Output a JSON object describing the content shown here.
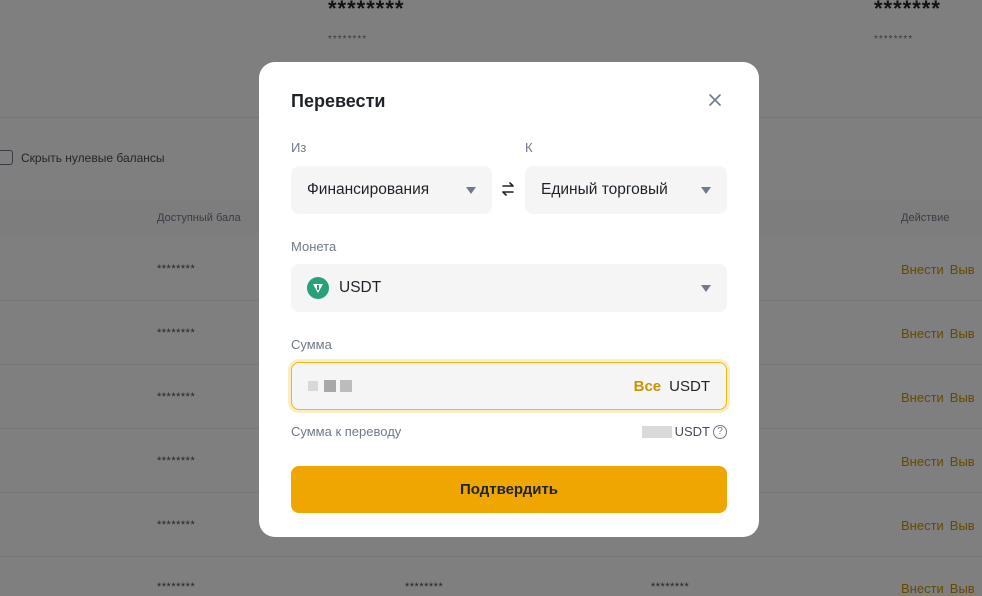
{
  "background": {
    "stats": [
      {
        "value": "********",
        "sub": "********"
      },
      {
        "value": "*******",
        "sub": "********"
      }
    ],
    "hide_zero_label": "Скрыть нулевые балансы",
    "table": {
      "headers": {
        "available": "Доступный бала",
        "action": "Действие"
      },
      "rows": [
        {
          "c1": "********",
          "deposit": "Внести",
          "withdraw": "Выв"
        },
        {
          "c1": "********",
          "deposit": "Внести",
          "withdraw": "Выв"
        },
        {
          "c1": "********",
          "deposit": "Внести",
          "withdraw": "Выв"
        },
        {
          "c1": "********",
          "deposit": "Внести",
          "withdraw": "Выв"
        },
        {
          "c1": "********",
          "deposit": "Внести",
          "withdraw": "Выв"
        },
        {
          "c1": "********",
          "c2": "********",
          "c3": "********",
          "deposit": "Внести",
          "withdraw": "Выв"
        }
      ]
    }
  },
  "modal": {
    "title": "Перевести",
    "from_label": "Из",
    "to_label": "К",
    "from_value": "Финансирования",
    "to_value": "Единый торговый",
    "coin_label": "Монета",
    "coin_value": "USDT",
    "amount_label": "Сумма",
    "max_label": "Все",
    "amount_unit": "USDT",
    "transfer_label": "Сумма к переводу",
    "transfer_unit": "USDT",
    "help_symbol": "?",
    "confirm_label": "Подтвердить",
    "colors": {
      "accent": "#f0a600",
      "link": "#c99400",
      "focus": "#f0b90b",
      "coin": "#26a17b"
    }
  }
}
